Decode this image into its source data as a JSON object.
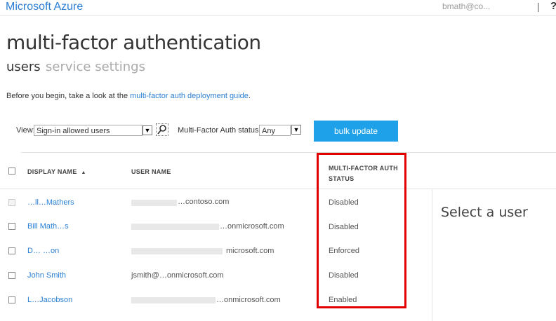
{
  "header": {
    "brand": "Microsoft Azure",
    "user_email": "bmath@co...",
    "separator": "|",
    "help": "?"
  },
  "page": {
    "title": "multi-factor authentication",
    "tabs": [
      {
        "label": "users",
        "active": true
      },
      {
        "label": "service settings",
        "active": false
      }
    ],
    "intro_text": "Before you begin, take a look at the ",
    "intro_link": "multi-factor auth deployment guide",
    "intro_end": "."
  },
  "filters": {
    "view_label": "View:",
    "view_value": "Sign-in allowed users",
    "status_label": "Multi-Factor Auth status:",
    "status_value": "Any",
    "bulk_update": "bulk update"
  },
  "table": {
    "headers": {
      "display_name": "DISPLAY NAME",
      "sort_indicator": "▲",
      "user_name": "USER NAME",
      "mfa_status_1": "MULTI-FACTOR AUTH",
      "mfa_status_2": "STATUS"
    },
    "rows": [
      {
        "display": "…ll…Mathers",
        "user": "…contoso.com",
        "status": "Disabled"
      },
      {
        "display": "Bill Math…s",
        "user": "…onmicrosoft.com",
        "status": "Disabled"
      },
      {
        "display": "D… …on",
        "user": "microsoft.com",
        "status": "Enforced"
      },
      {
        "display": "John Smith",
        "user": "jsmith@…onmicrosoft.com",
        "status": "Disabled"
      },
      {
        "display": "L…Jacobson",
        "user": "…onmicrosoft.com",
        "status": "Enabled"
      }
    ]
  },
  "detail_pane": {
    "placeholder": "Select a user"
  },
  "colors": {
    "accent": "#1ea1e8",
    "link": "#2a7fd4",
    "highlight": "#e00000"
  }
}
